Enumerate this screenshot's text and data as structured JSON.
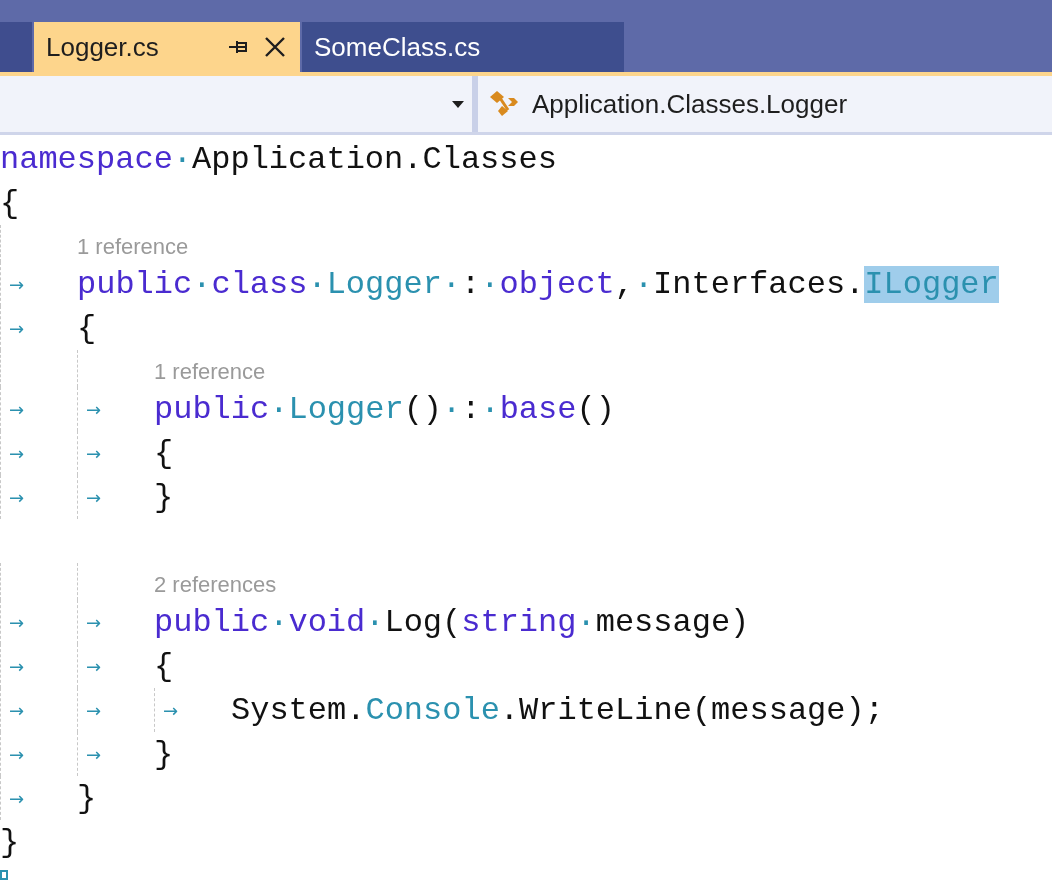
{
  "tabs": [
    {
      "label": "Logger.cs",
      "selected": true
    },
    {
      "label": "SomeClass.cs",
      "selected": false
    }
  ],
  "navigation_bar": {
    "type_path": "Application.Classes.Logger"
  },
  "code_lines": [
    {
      "kind": "code",
      "tokens": [
        {
          "kind": "kw",
          "text": "namespace"
        },
        {
          "kind": "ws",
          "text": "·"
        },
        {
          "kind": "text",
          "text": "Application.Classes"
        }
      ]
    },
    {
      "kind": "code",
      "tokens": [
        {
          "kind": "text",
          "text": "{"
        }
      ]
    },
    {
      "kind": "lens",
      "tokens": [
        {
          "kind": "indent"
        },
        {
          "kind": "lens",
          "text": "1 reference"
        }
      ]
    },
    {
      "kind": "code",
      "tokens": [
        {
          "kind": "tab",
          "text": "→"
        },
        {
          "kind": "kw",
          "text": "public"
        },
        {
          "kind": "ws",
          "text": "·"
        },
        {
          "kind": "kw",
          "text": "class"
        },
        {
          "kind": "ws",
          "text": "·"
        },
        {
          "kind": "type",
          "text": "Logger"
        },
        {
          "kind": "ws",
          "text": "·"
        },
        {
          "kind": "text",
          "text": ":"
        },
        {
          "kind": "ws",
          "text": "·"
        },
        {
          "kind": "kw",
          "text": "object"
        },
        {
          "kind": "text",
          "text": ","
        },
        {
          "kind": "ws",
          "text": "·"
        },
        {
          "kind": "text",
          "text": "Interfaces."
        },
        {
          "kind": "type",
          "text": "ILogger",
          "highlighted": true
        }
      ]
    },
    {
      "kind": "code",
      "tokens": [
        {
          "kind": "tab",
          "text": "→"
        },
        {
          "kind": "text",
          "text": "{"
        }
      ]
    },
    {
      "kind": "lens",
      "tokens": [
        {
          "kind": "indent"
        },
        {
          "kind": "indent"
        },
        {
          "kind": "lens",
          "text": "1 reference"
        }
      ]
    },
    {
      "kind": "code",
      "tokens": [
        {
          "kind": "tab",
          "text": "→"
        },
        {
          "kind": "tab",
          "text": "→"
        },
        {
          "kind": "kw",
          "text": "public"
        },
        {
          "kind": "ws",
          "text": "·"
        },
        {
          "kind": "type",
          "text": "Logger"
        },
        {
          "kind": "text",
          "text": "()"
        },
        {
          "kind": "ws",
          "text": "·"
        },
        {
          "kind": "text",
          "text": ":"
        },
        {
          "kind": "ws",
          "text": "·"
        },
        {
          "kind": "kw",
          "text": "base"
        },
        {
          "kind": "text",
          "text": "()"
        }
      ]
    },
    {
      "kind": "code",
      "tokens": [
        {
          "kind": "tab",
          "text": "→"
        },
        {
          "kind": "tab",
          "text": "→"
        },
        {
          "kind": "text",
          "text": "{"
        }
      ]
    },
    {
      "kind": "code",
      "tokens": [
        {
          "kind": "tab",
          "text": "→"
        },
        {
          "kind": "tab",
          "text": "→"
        },
        {
          "kind": "text",
          "text": "}"
        }
      ]
    },
    {
      "kind": "blank"
    },
    {
      "kind": "lens",
      "tokens": [
        {
          "kind": "indent"
        },
        {
          "kind": "indent"
        },
        {
          "kind": "lens",
          "text": "2 references"
        }
      ]
    },
    {
      "kind": "code",
      "tokens": [
        {
          "kind": "tab",
          "text": "→"
        },
        {
          "kind": "tab",
          "text": "→"
        },
        {
          "kind": "kw",
          "text": "public"
        },
        {
          "kind": "ws",
          "text": "·"
        },
        {
          "kind": "kw",
          "text": "void"
        },
        {
          "kind": "ws",
          "text": "·"
        },
        {
          "kind": "text",
          "text": "Log("
        },
        {
          "kind": "kw",
          "text": "string"
        },
        {
          "kind": "ws",
          "text": "·"
        },
        {
          "kind": "text",
          "text": "message)"
        }
      ]
    },
    {
      "kind": "code",
      "tokens": [
        {
          "kind": "tab",
          "text": "→"
        },
        {
          "kind": "tab",
          "text": "→"
        },
        {
          "kind": "text",
          "text": "{"
        }
      ]
    },
    {
      "kind": "code",
      "tokens": [
        {
          "kind": "tab",
          "text": "→"
        },
        {
          "kind": "tab",
          "text": "→"
        },
        {
          "kind": "tab",
          "text": "→"
        },
        {
          "kind": "text",
          "text": "System."
        },
        {
          "kind": "type",
          "text": "Console"
        },
        {
          "kind": "text",
          "text": ".WriteLine(message);"
        }
      ]
    },
    {
      "kind": "code",
      "tokens": [
        {
          "kind": "tab",
          "text": "→"
        },
        {
          "kind": "tab",
          "text": "→"
        },
        {
          "kind": "text",
          "text": "}"
        }
      ]
    },
    {
      "kind": "code",
      "tokens": [
        {
          "kind": "tab",
          "text": "→"
        },
        {
          "kind": "text",
          "text": "}"
        }
      ]
    },
    {
      "kind": "code",
      "tokens": [
        {
          "kind": "text",
          "text": "}"
        }
      ]
    },
    {
      "kind": "end"
    }
  ]
}
